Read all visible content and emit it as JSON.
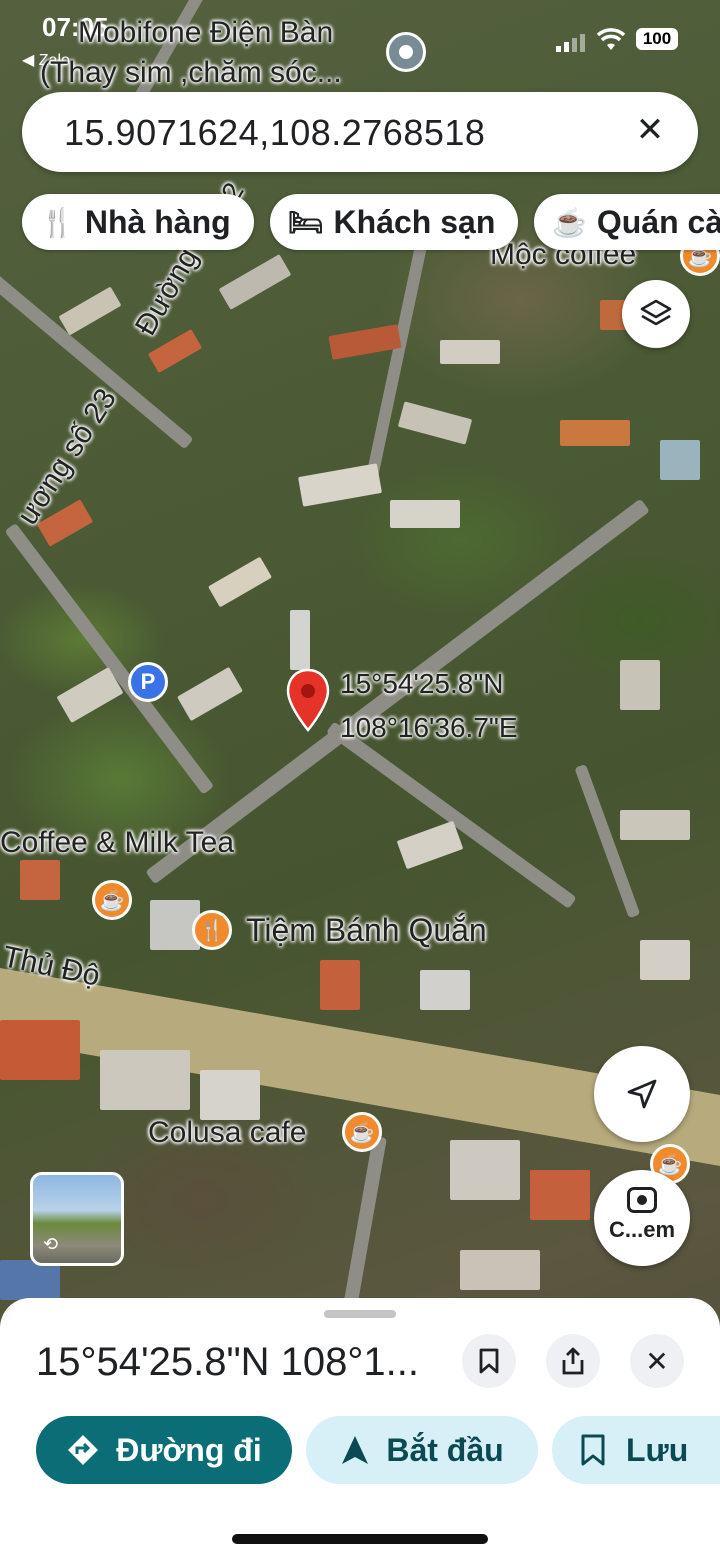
{
  "status_bar": {
    "time": "07:05",
    "back_app": "Zalo",
    "battery": "100"
  },
  "header": {
    "place_line1": "Mobifone Điện Bàn",
    "place_line2": "(Thay sim ,chăm sóc..."
  },
  "search": {
    "query": "15.9071624,108.2768518",
    "clear_icon": "close-icon"
  },
  "chips": [
    {
      "label": "Nhà hàng",
      "icon": "restaurant-icon"
    },
    {
      "label": "Khách sạn",
      "icon": "hotel-icon"
    },
    {
      "label": "Quán cà",
      "icon": "cafe-icon"
    }
  ],
  "map": {
    "labels": {
      "moc_coffee": "Mộc coffee",
      "road_23": "ương số 23",
      "road_duong": "Đường",
      "road_2": "2",
      "coffee_milk_tea": "Coffee & Milk Tea",
      "tiem_banh": "Tiệm Bánh Quắn",
      "thu_do": "Thủ Độ",
      "colusa": "Colusa cafe"
    },
    "pin": {
      "lat": "15°54'25.8\"N",
      "lng": "108°16'36.7\"E"
    },
    "street_view_thumb": "street-view-thumbnail",
    "camera_label": "C...em"
  },
  "sheet": {
    "title": "15°54'25.8\"N 108°1...",
    "actions": {
      "directions": "Đường đi",
      "start": "Bắt đầu",
      "save": "Lưu"
    }
  },
  "colors": {
    "primary": "#0b6e77",
    "primary_light": "#d7f0f7",
    "pin_red": "#e5332a",
    "poi_orange": "#f08a2c",
    "parking_blue": "#3a73e8"
  }
}
